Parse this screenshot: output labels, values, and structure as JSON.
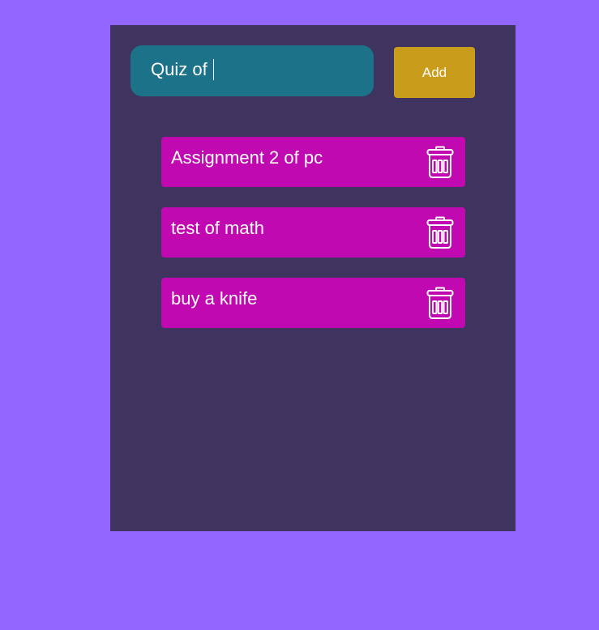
{
  "input": {
    "value": "Quiz of "
  },
  "add_button": {
    "label": "Add"
  },
  "todos": [
    {
      "label": "Assignment 2 of pc",
      "icon": "trash-icon"
    },
    {
      "label": "test of math",
      "icon": "trash-icon"
    },
    {
      "label": "buy a knife",
      "icon": "trash-icon"
    }
  ],
  "colors": {
    "background": "#9265fe",
    "panel": "#3f345f",
    "input": "#1c7289",
    "button": "#c99d1b",
    "item": "#c009b0",
    "text": "#ffffff"
  }
}
